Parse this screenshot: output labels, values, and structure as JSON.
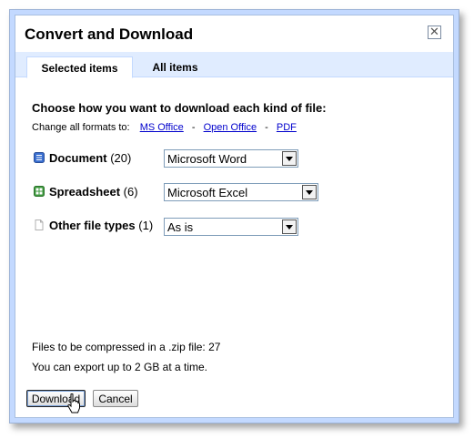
{
  "dialog": {
    "title": "Convert and Download",
    "close_icon": "close-icon"
  },
  "tabs": [
    {
      "label": "Selected items",
      "selected": true
    },
    {
      "label": "All items",
      "selected": false
    }
  ],
  "content": {
    "heading": "Choose how you want to download each kind of file:",
    "change_all_label": "Change all formats to:",
    "change_links": [
      "MS Office",
      "Open Office",
      "PDF"
    ],
    "separator": "-"
  },
  "file_types": [
    {
      "name": "Document",
      "count": "(20)",
      "icon": "document-icon",
      "icon_color": "#3a6fd0",
      "format": "Microsoft Word"
    },
    {
      "name": "Spreadsheet",
      "count": "(6)",
      "icon": "spreadsheet-icon",
      "icon_color": "#3f9a3f",
      "format": "Microsoft Excel"
    },
    {
      "name": "Other file types",
      "count": "(1)",
      "icon": "file-icon",
      "icon_color": "#cccccc",
      "format": "As is"
    }
  ],
  "footer": {
    "compressed_info": "Files to be compressed in a .zip file: 27",
    "export_limit": "You can export up to 2 GB at a time.",
    "download_label": "Download",
    "cancel_label": "Cancel"
  }
}
